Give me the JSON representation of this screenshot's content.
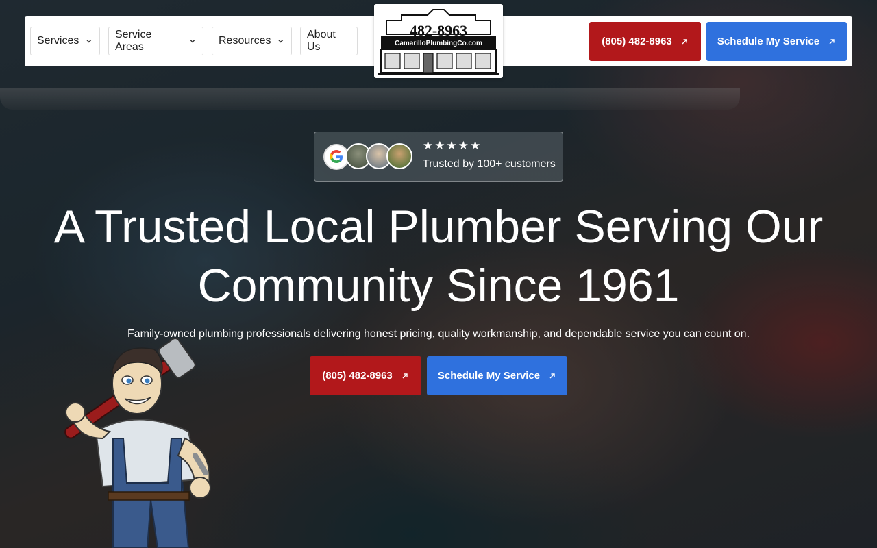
{
  "nav": {
    "items": [
      {
        "label": "Services",
        "has_dropdown": true
      },
      {
        "label": "Service Areas",
        "has_dropdown": true
      },
      {
        "label": "Resources",
        "has_dropdown": true
      },
      {
        "label": "About Us",
        "has_dropdown": false
      }
    ]
  },
  "logo": {
    "phone": "482-8963",
    "name": "CamarilloPlumbingCo.com"
  },
  "header_cta": {
    "phone_label": "(805) 482-8963",
    "schedule_label": "Schedule My Service"
  },
  "rating": {
    "stars": "★★★★★",
    "text": "Trusted by 100+ customers",
    "icons": [
      "google-icon",
      "customer-avatar",
      "customer-avatar",
      "customer-avatar"
    ]
  },
  "hero": {
    "title_line1": "A Trusted Local Plumber Serving Our",
    "title_line2": "Community Since 1961",
    "subtitle": "Family-owned plumbing professionals delivering honest pricing, quality workmanship, and dependable service you can count on.",
    "phone_label": "(805) 482-8963",
    "schedule_label": "Schedule My Service"
  },
  "colors": {
    "cta_red": "#b2181b",
    "cta_blue": "#2f71de",
    "header_bg": "#ffffff"
  }
}
